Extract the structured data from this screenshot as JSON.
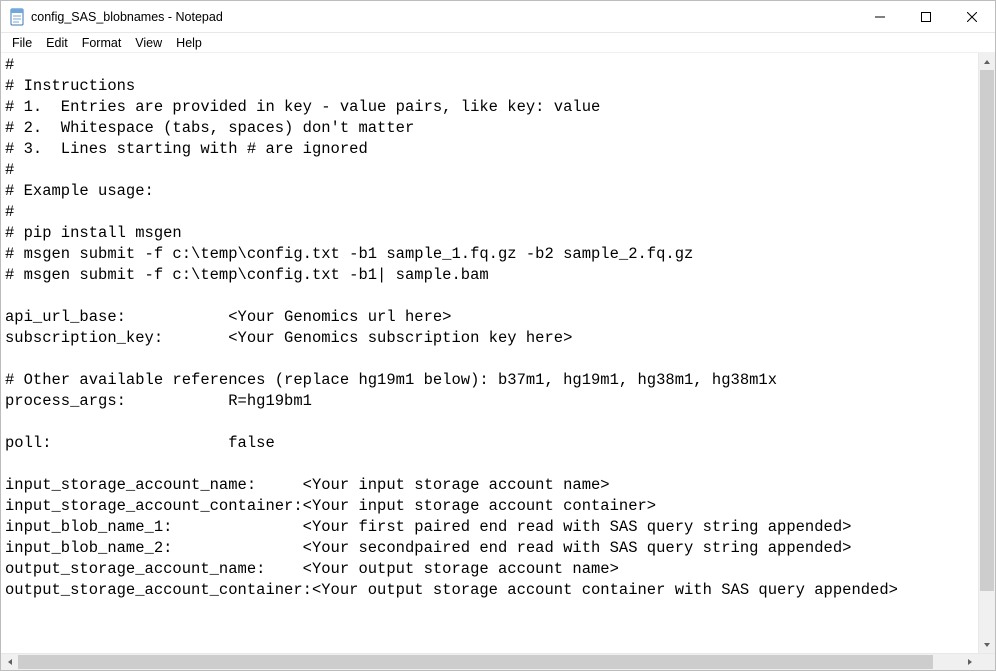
{
  "window": {
    "title": "config_SAS_blobnames - Notepad"
  },
  "menu": {
    "file": "File",
    "edit": "Edit",
    "format": "Format",
    "view": "View",
    "help": "Help"
  },
  "editor": {
    "text": "#\n# Instructions\n# 1.  Entries are provided in key - value pairs, like key: value\n# 2.  Whitespace (tabs, spaces) don't matter\n# 3.  Lines starting with # are ignored\n#\n# Example usage:\n#\n# pip install msgen\n# msgen submit -f c:\\temp\\config.txt -b1 sample_1.fq.gz -b2 sample_2.fq.gz\n# msgen submit -f c:\\temp\\config.txt -b1| sample.bam\n\napi_url_base:           <Your Genomics url here>\nsubscription_key:       <Your Genomics subscription key here>\n\n# Other available references (replace hg19m1 below): b37m1, hg19m1, hg38m1, hg38m1x\nprocess_args:           R=hg19bm1\n\npoll:                   false\n\ninput_storage_account_name:     <Your input storage account name>\ninput_storage_account_container:<Your input storage account container>\ninput_blob_name_1:              <Your first paired end read with SAS query string appended>\ninput_blob_name_2:              <Your secondpaired end read with SAS query string appended>\noutput_storage_account_name:    <Your output storage account name>\noutput_storage_account_container:<Your output storage account container with SAS query appended>"
  },
  "win_controls": {
    "minimize": "—",
    "maximize": "☐",
    "close": "✕"
  },
  "scroll": {
    "up": "▲",
    "down": "▼",
    "left": "◀",
    "right": "▶"
  }
}
